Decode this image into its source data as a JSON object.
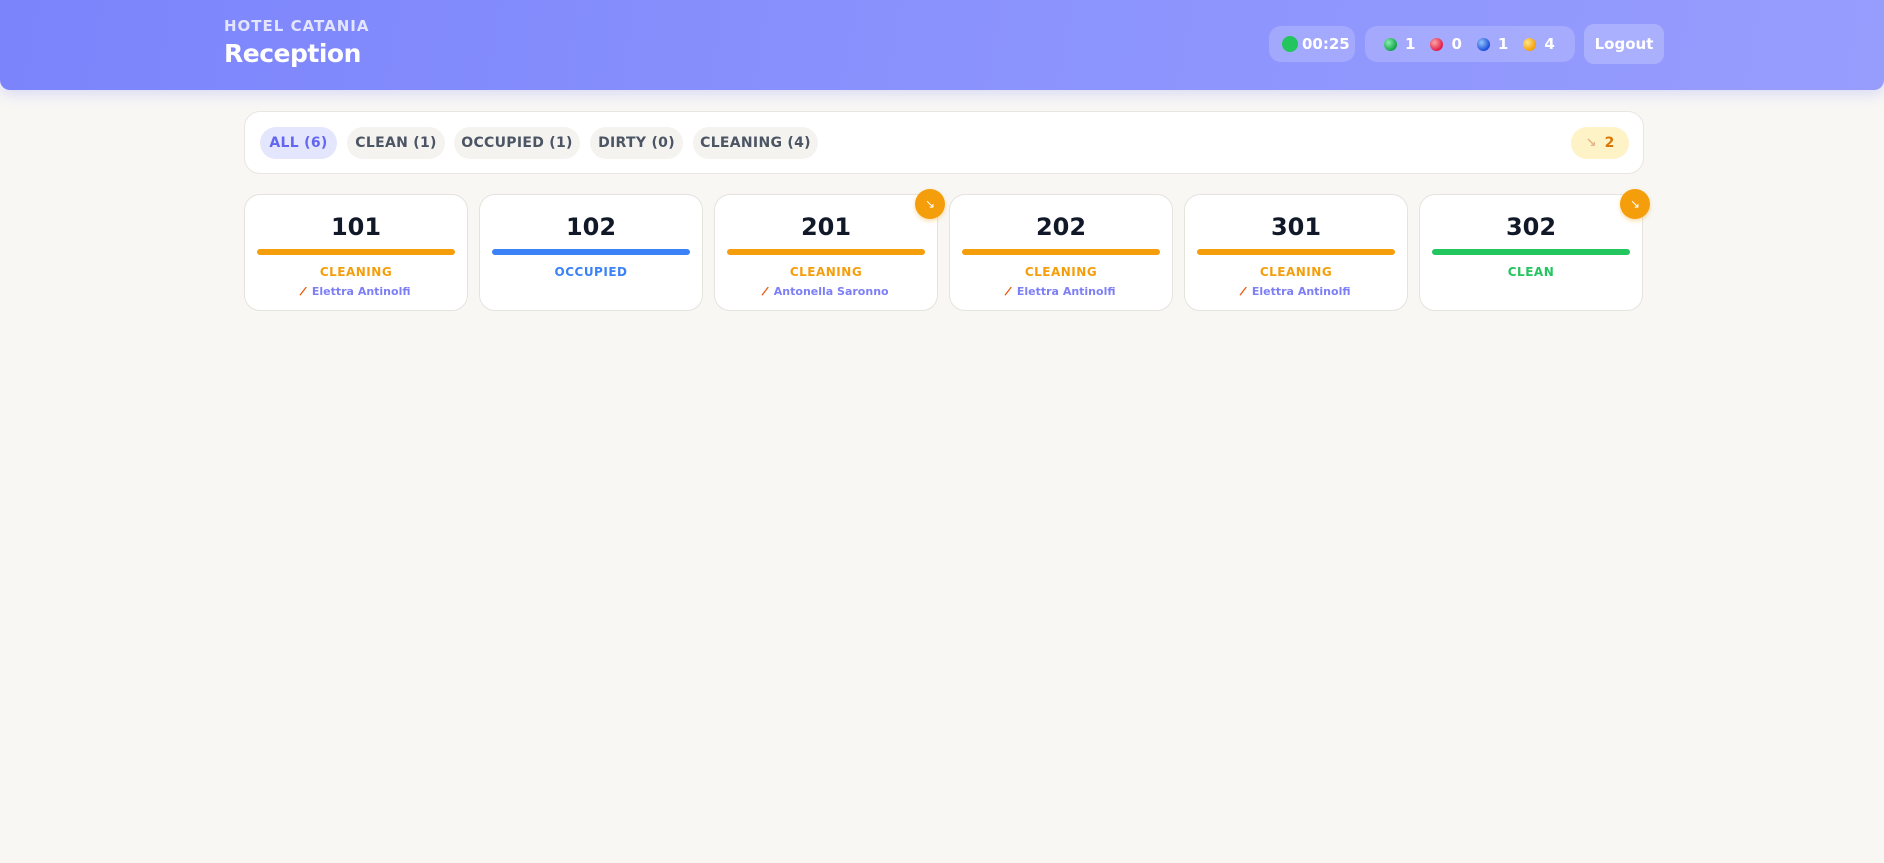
{
  "header": {
    "hotel_name": "HOTEL CATANIA",
    "title": "Reception",
    "timer": "00:25",
    "counts": [
      {
        "color": "green",
        "value": "1"
      },
      {
        "color": "red",
        "value": "0"
      },
      {
        "color": "blue",
        "value": "1"
      },
      {
        "color": "orange",
        "value": "4"
      }
    ],
    "logout_label": "Logout"
  },
  "filters": {
    "chips": [
      {
        "label": "ALL (6)",
        "active": true
      },
      {
        "label": "CLEAN (1)",
        "active": false
      },
      {
        "label": "OCCUPIED (1)",
        "active": false
      },
      {
        "label": "DIRTY (0)",
        "active": false
      },
      {
        "label": "CLEANING (4)",
        "active": false
      }
    ],
    "maintenance_icon": "wrench-icon",
    "maintenance_count": "2"
  },
  "rooms": [
    {
      "number": "101",
      "status": "CLEANING",
      "status_color": "#f59e0b",
      "staff": "Elettra Antinolfi",
      "maintenance": false
    },
    {
      "number": "102",
      "status": "OCCUPIED",
      "status_color": "#3b82f6",
      "staff": "",
      "maintenance": false
    },
    {
      "number": "201",
      "status": "CLEANING",
      "status_color": "#f59e0b",
      "staff": "Antonella Saronno",
      "maintenance": true
    },
    {
      "number": "202",
      "status": "CLEANING",
      "status_color": "#f59e0b",
      "staff": "Elettra Antinolfi",
      "maintenance": false
    },
    {
      "number": "301",
      "status": "CLEANING",
      "status_color": "#f59e0b",
      "staff": "Elettra Antinolfi",
      "maintenance": false
    },
    {
      "number": "302",
      "status": "CLEAN",
      "status_color": "#22c55e",
      "staff": "",
      "maintenance": true
    }
  ]
}
